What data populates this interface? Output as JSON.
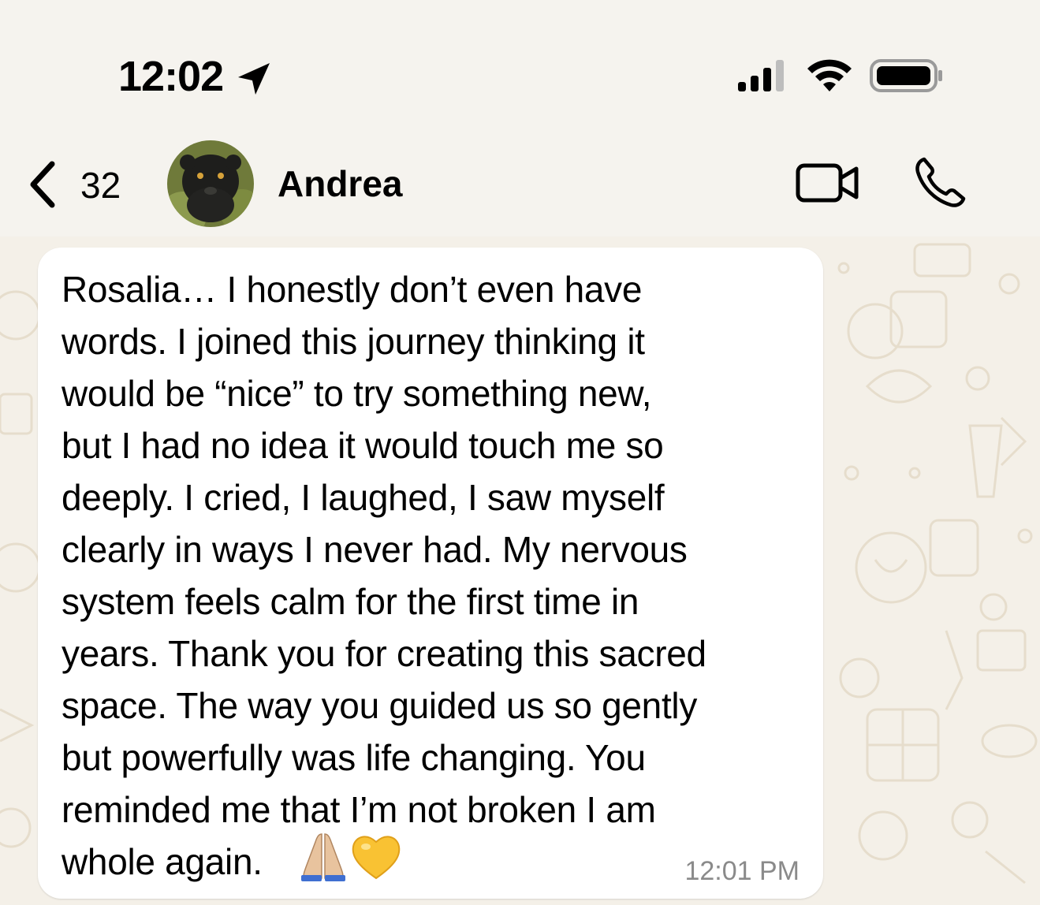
{
  "status_bar": {
    "time": "12:02",
    "icons": [
      "location-arrow-icon",
      "signal-icon",
      "wifi-icon",
      "battery-icon"
    ]
  },
  "header": {
    "back_count": "32",
    "contact_name": "Andrea",
    "icons": [
      "chevron-left-icon",
      "video-call-icon",
      "phone-call-icon"
    ]
  },
  "message": {
    "text": "Rosalia… I honestly don’t even have\nwords. I joined this journey thinking it\nwould be “nice” to try something new,\nbut I had no idea it would touch me so\ndeeply. I cried, I laughed, I saw myself\nclearly in ways I never had. My nervous\nsystem feels calm for the first time in\nyears. Thank you for creating this sacred\nspace. The way you guided us so gently\nbut powerfully was life changing. You\nreminded me that I’m not broken I am\nwhole again.",
    "emojis": [
      "folded-hands",
      "yellow-heart"
    ],
    "time": "12:01 PM"
  },
  "colors": {
    "background": "#f4f0e8",
    "bubble": "#ffffff",
    "timestamp": "#8a8a8a"
  }
}
